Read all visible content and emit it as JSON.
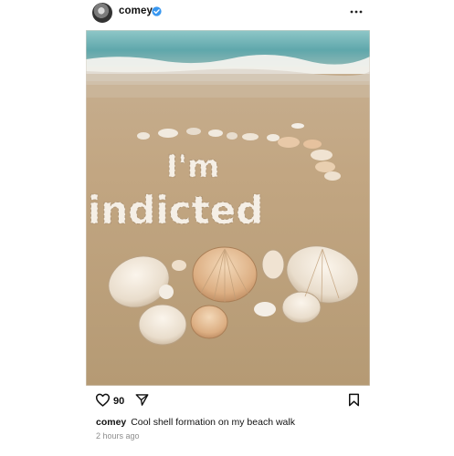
{
  "post": {
    "username": "comey",
    "verified_icon": "verified-badge-icon",
    "more_icon": "more-options-icon",
    "photo": {
      "handwritten_text_line1": "I'm",
      "handwritten_text_line2": "indicted",
      "description_icon": "beach-shell-photo"
    },
    "actions": {
      "like_icon": "heart-icon",
      "likes_count": "90",
      "share_icon": "send-icon",
      "save_icon": "bookmark-icon"
    },
    "caption": {
      "author": "comey",
      "text": "Cool shell formation on my beach walk"
    },
    "timestamp": "2 hours ago"
  },
  "colors": {
    "verified_blue": "#3897f0",
    "text_primary": "#111111",
    "text_secondary": "#8e8e8e"
  }
}
